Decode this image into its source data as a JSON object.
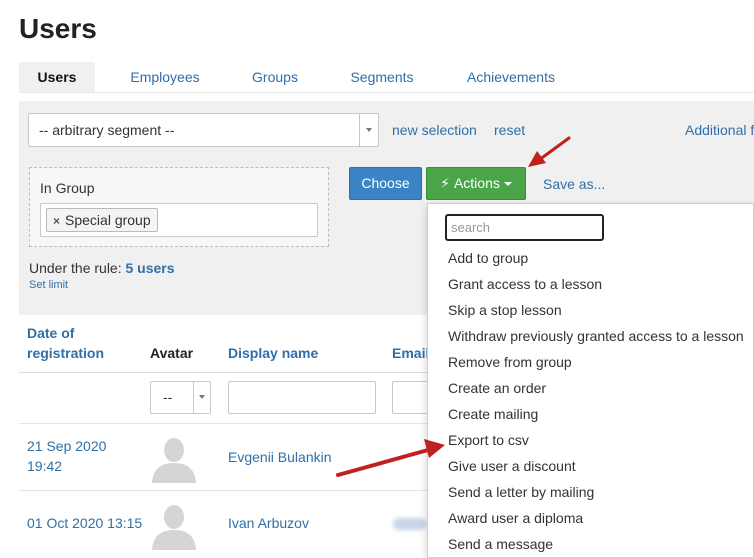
{
  "page": {
    "title": "Users"
  },
  "tabs": [
    "Users",
    "Employees",
    "Groups",
    "Segments",
    "Achievements"
  ],
  "filter": {
    "segment_value": "-- arbitrary segment --",
    "new_selection": "new selection",
    "reset": "reset",
    "additional_filters": "Additional filters",
    "group_label": "In Group",
    "group_tag": "Special group",
    "rule_prefix": "Under the rule:",
    "rule_count": "5 users",
    "set_limit": "Set limit"
  },
  "buttons": {
    "choose": "Choose",
    "actions": "Actions",
    "save_as": "Save as..."
  },
  "actions_menu": {
    "search_placeholder": "search",
    "items": [
      "Add to group",
      "Grant access to a lesson",
      "Skip a stop lesson",
      "Withdraw previously granted access to a lesson",
      "Remove from group",
      "Create an order",
      "Create mailing",
      "Export to csv",
      "Give user a discount",
      "Send a letter by mailing",
      "Award user a diploma",
      "Send a message"
    ]
  },
  "table": {
    "headers": {
      "date_line1": "Date of",
      "date_line2": "registration",
      "avatar": "Avatar",
      "display_name": "Display name",
      "email": "Email"
    },
    "avatar_filter_value": "--",
    "rows": [
      {
        "date_line1": "21 Sep 2020",
        "date_line2": "19:42",
        "name": "Evgenii Bulankin"
      },
      {
        "date_line1": "01 Oct 2020 13:15",
        "date_line2": "",
        "name": "Ivan Arbuzov"
      }
    ]
  },
  "colors": {
    "link": "#2f6fa7",
    "choose_button": "#3a83c4",
    "actions_button": "#4aa548",
    "annotation_arrow": "#c0201e"
  }
}
